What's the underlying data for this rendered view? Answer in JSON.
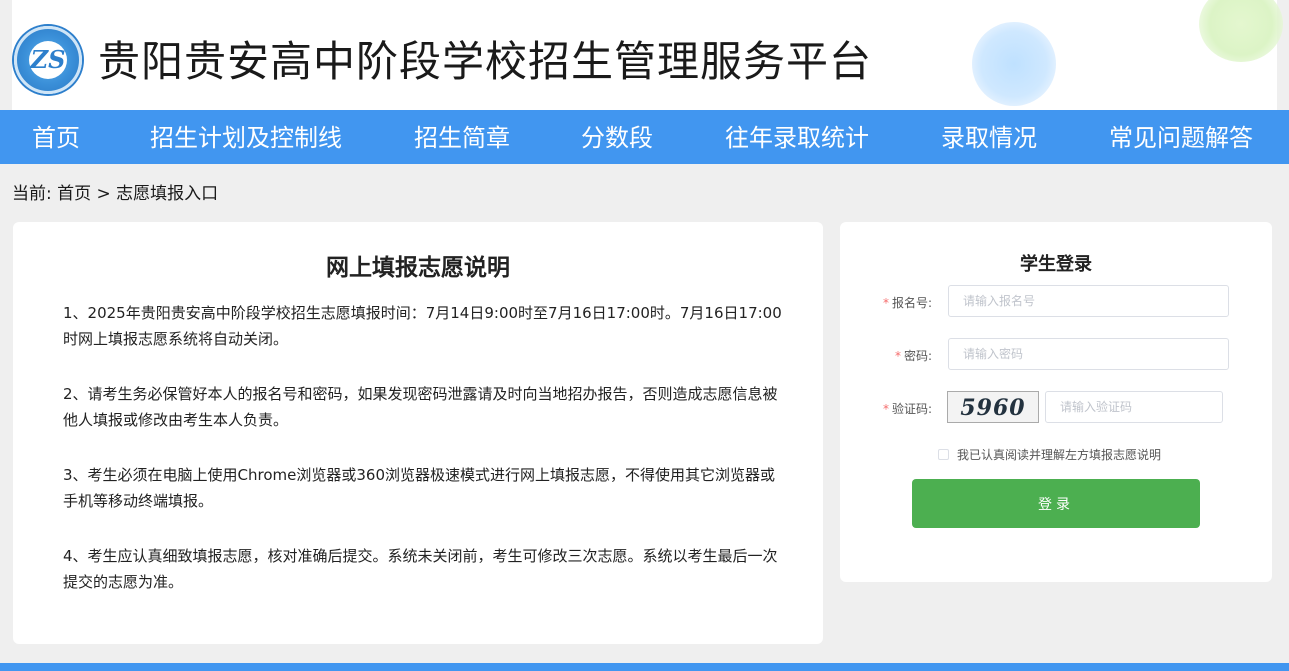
{
  "header": {
    "title": "贵阳贵安高中阶段学校招生管理服务平台",
    "logo_icon": "school-emblem-icon",
    "logo_text": "ZS"
  },
  "nav": {
    "items": [
      {
        "label": "首页"
      },
      {
        "label": "招生计划及控制线"
      },
      {
        "label": "招生简章"
      },
      {
        "label": "分数段"
      },
      {
        "label": "往年录取统计"
      },
      {
        "label": "录取情况"
      },
      {
        "label": "常见问题解答"
      }
    ]
  },
  "breadcrumb": {
    "text": "当前: 首页 > 志愿填报入口"
  },
  "instructions": {
    "title": "网上填报志愿说明",
    "paragraphs": [
      "1、2025年贵阳贵安高中阶段学校招生志愿填报时间：7月14日9:00时至7月16日17:00时。7月16日17:00时网上填报志愿系统将自动关闭。",
      "2、请考生务必保管好本人的报名号和密码，如果发现密码泄露请及时向当地招办报告，否则造成志愿信息被他人填报或修改由考生本人负责。",
      "3、考生必须在电脑上使用Chrome浏览器或360浏览器极速模式进行网上填报志愿，不得使用其它浏览器或手机等移动终端填报。",
      "4、考生应认真细致填报志愿，核对准确后提交。系统未关闭前，考生可修改三次志愿。系统以考生最后一次提交的志愿为准。"
    ]
  },
  "login": {
    "title": "学生登录",
    "required_mark": "*",
    "reg_label": "报名号:",
    "reg_placeholder": "请输入报名号",
    "reg_value": "",
    "pwd_label": "密码:",
    "pwd_placeholder": "请输入密码",
    "pwd_value": "",
    "captcha_label": "验证码:",
    "captcha_image_text": "5960",
    "captcha_placeholder": "请输入验证码",
    "captcha_value": "",
    "agree_text": "我已认真阅读并理解左方填报志愿说明",
    "agree_checked": false,
    "submit_label": "登录"
  },
  "colors": {
    "nav_bg": "#4196f0",
    "login_button": "#4caf50",
    "required": "#f56c6c",
    "page_bg": "#efefef"
  }
}
